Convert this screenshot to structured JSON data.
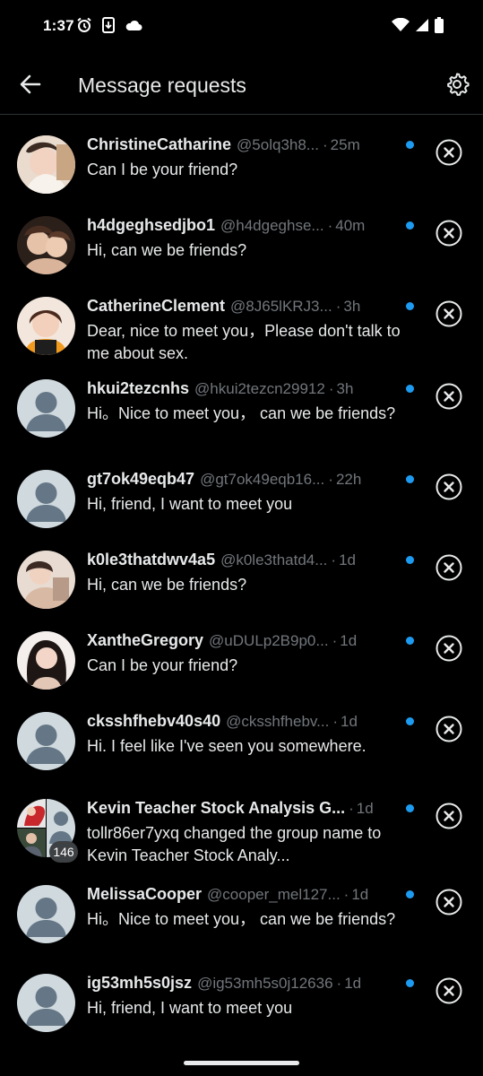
{
  "status_bar": {
    "time": "1:37",
    "icons_left": [
      "alarm-icon",
      "download-icon",
      "cloud-icon"
    ],
    "icons_right": [
      "wifi-icon",
      "signal-icon",
      "battery-icon"
    ]
  },
  "header": {
    "title": "Message requests",
    "back_icon": "arrow-left-icon",
    "settings_icon": "gear-icon"
  },
  "colors": {
    "background": "#000000",
    "text": "#e7e9ea",
    "muted": "#71767b",
    "accent": "#1d9bf0",
    "divider": "#2f3336"
  },
  "requests": [
    {
      "name": "ChristineCatharine",
      "handle": "@5olq3h8...",
      "time": "25m",
      "message": "Can I be your friend?",
      "avatar": "photo",
      "avatar_color": "#b07a5a"
    },
    {
      "name": "h4dgeghsedjbo1",
      "handle": "@h4dgeghse...",
      "time": "40m",
      "message": "Hi, can we be friends?",
      "avatar": "photo",
      "avatar_color": "#6b4a3a"
    },
    {
      "name": "CatherineClement",
      "handle": "@8J65lKRJ3...",
      "time": "3h",
      "message": "Dear, nice to meet you，Please don't talk to me about sex.",
      "avatar": "photo",
      "avatar_color": "#e08a2a"
    },
    {
      "name": "hkui2tezcnhs",
      "handle": "@hkui2tezcn29912",
      "time": "3h",
      "message": "Hi。Nice to meet you， can we be friends?",
      "avatar": "default"
    },
    {
      "name": "gt7ok49eqb47",
      "handle": "@gt7ok49eqb16...",
      "time": "22h",
      "message": "Hi, friend, I want to meet you",
      "avatar": "default"
    },
    {
      "name": "k0le3thatdwv4a5",
      "handle": "@k0le3thatd4...",
      "time": "1d",
      "message": "Hi, can we be friends?",
      "avatar": "photo",
      "avatar_color": "#c9a58e"
    },
    {
      "name": "XantheGregory",
      "handle": "@uDULp2B9p0...",
      "time": "1d",
      "message": "Can I be your friend?",
      "avatar": "photo",
      "avatar_color": "#3a2a2a"
    },
    {
      "name": "cksshfhebv40s40",
      "handle": "@cksshfhebv...",
      "time": "1d",
      "message": "Hi. I feel like I've seen you somewhere.",
      "avatar": "default"
    },
    {
      "name": "Kevin Teacher Stock Analysis G...",
      "handle": "",
      "time": "1d",
      "message": "tollr86er7yxq changed the group name to Kevin Teacher Stock Analy...",
      "avatar": "group",
      "member_count": "146"
    },
    {
      "name": "MelissaCooper",
      "handle": "@cooper_mel127...",
      "time": "1d",
      "message": "Hi。Nice to meet you， can we be friends?",
      "avatar": "default"
    },
    {
      "name": "ig53mh5s0jsz",
      "handle": "@ig53mh5s0j12636",
      "time": "1d",
      "message": "Hi, friend, I want to meet you",
      "avatar": "default"
    }
  ],
  "dot_separator": "·",
  "dismiss_icon": "close-circle-icon"
}
